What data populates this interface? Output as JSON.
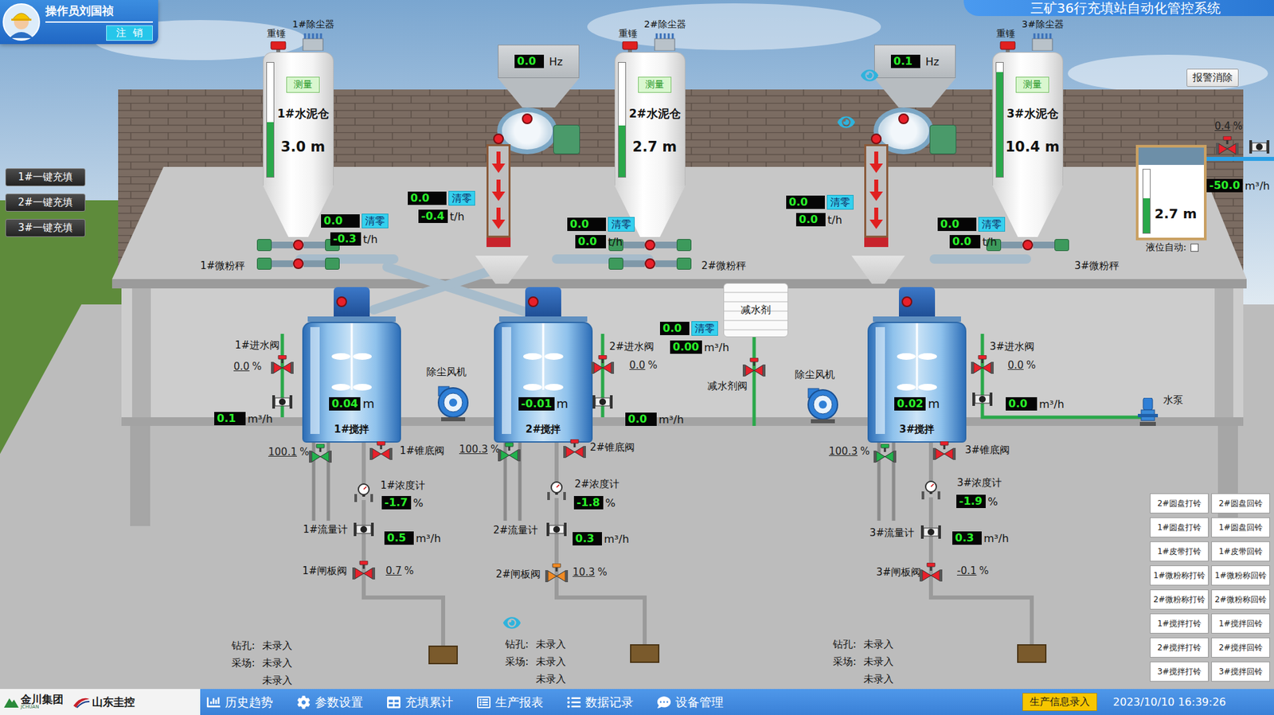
{
  "operator": {
    "name": "操作员刘国祯",
    "logout": "注  销"
  },
  "title": "三矿36行充填站自动化管控系统",
  "alarm_reset": "报警消除",
  "one_click_buttons": [
    "1#一键充填",
    "2#一键充填",
    "3#一键充填"
  ],
  "silos": [
    {
      "name": "1#水泥仓",
      "measure": "测量",
      "reading": "3.0",
      "unit": "m",
      "level": 0.48,
      "hammer": "重锤",
      "duster": "1#除尘器",
      "screw_colors": [
        "#e8202a",
        "#e8202a"
      ],
      "scale": {
        "label": "1#微粉秤",
        "value": "0.0",
        "clear": "清零",
        "flow": "-0.3",
        "unit": "t/h"
      }
    },
    {
      "name": "2#水泥仓",
      "measure": "测量",
      "reading": "2.7",
      "unit": "m",
      "level": 0.45,
      "hammer": "重锤",
      "duster": "2#除尘器",
      "screw_colors": [
        "#e8202a",
        "#e8202a"
      ],
      "scale": {
        "label": "2#微粉秤",
        "value": "0.0",
        "clear": "清零",
        "flow": "0.0",
        "unit": "t/h"
      }
    },
    {
      "name": "3#水泥仓",
      "measure": "测量",
      "reading": "10.4",
      "unit": "m",
      "level": 0.92,
      "hammer": "重锤",
      "duster": "3#除尘器",
      "screw_colors": [
        "#e8202a"
      ],
      "scale": {
        "label": "3#微粉秤",
        "value": "0.0",
        "clear": "清零",
        "flow": "0.0",
        "unit": "t/h"
      }
    }
  ],
  "feeders": [
    {
      "frequency": "0.0",
      "unit": "Hz",
      "disc_color": "#e8202a",
      "belt_color": "#e8202a",
      "belt": {
        "value": "0.0",
        "clear": "清零",
        "flow": "-0.4",
        "unit": "t/h"
      }
    },
    {
      "frequency": "0.1",
      "unit": "Hz",
      "disc_color": "#e8202a",
      "belt_color": "#e8202a",
      "belt": {
        "value": "0.0",
        "clear": "清零",
        "flow": "0.0",
        "unit": "t/h"
      }
    }
  ],
  "mixers": [
    {
      "name": "1#搅拌",
      "reading": "0.04",
      "unit": "m",
      "motor_color": "#e8202a",
      "inlet": {
        "label": "1#进水阀",
        "value": "0.0",
        "unit": "%",
        "color": "#e8202a"
      },
      "water": {
        "value": "0.1",
        "unit": "m³/h"
      },
      "flush": {
        "value": "100.1",
        "unit": "%",
        "color": "#22b14c"
      },
      "cone": {
        "label": "1#锥底阀",
        "color": "#e8202a"
      },
      "density": {
        "label": "1#浓度计",
        "value": "-1.7",
        "unit": "%"
      },
      "flowmeter": {
        "label": "1#流量计",
        "value": "0.5",
        "unit": "m³/h"
      },
      "gate": {
        "label": "1#闸板阀",
        "value": "0.7",
        "unit": "%",
        "color": "#e8202a"
      },
      "info": [
        {
          "label": "钻孔:",
          "value": "未录入"
        },
        {
          "label": "采场:",
          "value": "未录入"
        },
        {
          "label": "",
          "value": "未录入"
        }
      ]
    },
    {
      "name": "2#搅拌",
      "reading": "-0.01",
      "unit": "m",
      "motor_color": "#e8202a",
      "inlet": {
        "label": "2#进水阀",
        "value": "0.0",
        "unit": "%",
        "color": "#e8202a"
      },
      "water": {
        "value": "0.0",
        "unit": "m³/h"
      },
      "flush": {
        "value": "100.3",
        "unit": "%",
        "color": "#22b14c"
      },
      "cone": {
        "label": "2#锥底阀",
        "color": "#e8202a"
      },
      "density": {
        "label": "2#浓度计",
        "value": "-1.8",
        "unit": "%"
      },
      "flowmeter": {
        "label": "2#流量计",
        "value": "0.3",
        "unit": "m³/h"
      },
      "gate": {
        "label": "2#闸板阀",
        "value": "10.3",
        "unit": "%",
        "color": "#f08a24"
      },
      "info": [
        {
          "label": "钻孔:",
          "value": "未录入"
        },
        {
          "label": "采场:",
          "value": "未录入"
        },
        {
          "label": "",
          "value": "未录入"
        }
      ]
    },
    {
      "name": "3#搅拌",
      "reading": "0.02",
      "unit": "m",
      "motor_color": "#e8202a",
      "inlet": {
        "label": "3#进水阀",
        "value": "0.0",
        "unit": "%",
        "color": "#e8202a"
      },
      "water": {
        "value": "0.0",
        "unit": "m³/h"
      },
      "flush": {
        "value": "100.3",
        "unit": "%",
        "color": "#22b14c"
      },
      "cone": {
        "label": "3#锥底阀",
        "color": "#e8202a"
      },
      "density": {
        "label": "3#浓度计",
        "value": "-1.9",
        "unit": "%"
      },
      "flowmeter": {
        "label": "3#流量计",
        "value": "0.3",
        "unit": "m³/h"
      },
      "gate": {
        "label": "3#闸板阀",
        "value": "-0.1",
        "unit": "%",
        "color": "#e8202a"
      },
      "info": [
        {
          "label": "钻孔:",
          "value": "未录入"
        },
        {
          "label": "采场:",
          "value": "未录入"
        },
        {
          "label": "",
          "value": "未录入"
        }
      ]
    }
  ],
  "reducer": {
    "name": "减水剂",
    "valve_label": "减水剂阀",
    "valve_color": "#e8202a",
    "value": "0.0",
    "clear": "清零",
    "flow": "0.00",
    "unit": "m³/h"
  },
  "fans": [
    {
      "label": "除尘风机"
    },
    {
      "label": "除尘风机"
    }
  ],
  "water_tank": {
    "reading": "2.7",
    "unit": "m",
    "level": 0.55,
    "valve_opening": "0.4",
    "valve_unit": "%",
    "valve_color": "#e8202a",
    "flow": "-50.0",
    "flow_unit": "m³/h",
    "auto_label": "液位自动:",
    "auto": false
  },
  "pump": {
    "label": "水泵"
  },
  "bell_buttons": [
    "2#圆盘打铃",
    "2#圆盘回铃",
    "1#圆盘打铃",
    "1#圆盘回铃",
    "1#皮带打铃",
    "1#皮带回铃",
    "1#微粉称打铃",
    "1#微粉称回铃",
    "2#微粉称打铃",
    "2#微粉称回铃",
    "1#搅拌打铃",
    "1#搅拌回铃",
    "2#搅拌打铃",
    "2#搅拌回铃",
    "3#搅拌打铃",
    "3#搅拌回铃"
  ],
  "footer": {
    "logos": [
      {
        "name": "金川集团",
        "sub": "JCHUAN"
      },
      {
        "name": "山东圭控",
        "sub": ""
      }
    ],
    "nav": [
      "历史趋势",
      "参数设置",
      "充填累计",
      "生产报表",
      "数据记录",
      "设备管理"
    ],
    "entry": "生产信息录入",
    "time": "2023/10/10 16:39:26"
  }
}
